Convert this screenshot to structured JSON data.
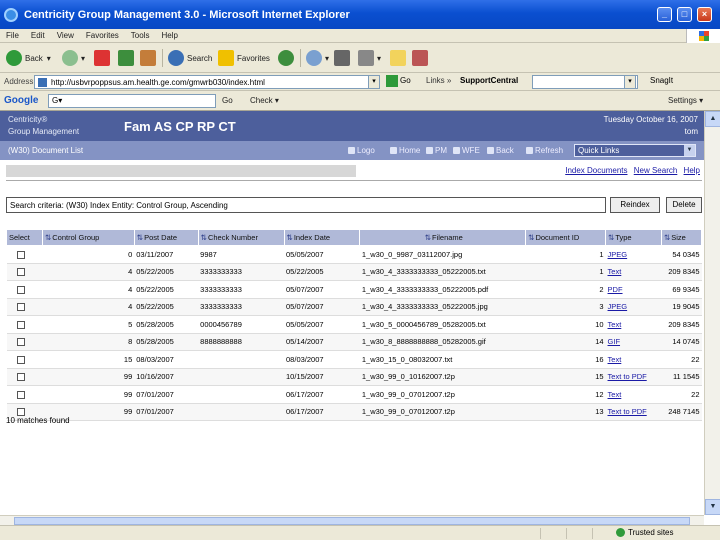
{
  "window": {
    "title": "Centricity Group Management 3.0 - Microsoft Internet Explorer",
    "minimize": "_",
    "maximize": "□",
    "close": "×"
  },
  "menu": [
    "File",
    "Edit",
    "View",
    "Favorites",
    "Tools",
    "Help"
  ],
  "toolbar": {
    "back": "Back",
    "search": "Search",
    "favorites": "Favorites"
  },
  "address": {
    "label": "Address",
    "url": "http://usbvrpoppsus.am.health.ge.com/gmwrb030/index.html",
    "go": "Go",
    "links": "Links",
    "support": "SupportCentral",
    "snagit": "SnagIt"
  },
  "google": {
    "logo": "Google",
    "input": "G▾",
    "go": "Go",
    "check": "Check ▾",
    "settings": "Settings ▾"
  },
  "app": {
    "brand_line1": "Centricity®",
    "brand_line2": "Group Management",
    "patient": "Fam AS CP RP CT",
    "date": "Tuesday October 16, 2007",
    "user": "tom",
    "page_title": "(W30) Document List",
    "nav": [
      "Logo",
      "Home",
      "PM",
      "WFE",
      "Back",
      "Refresh"
    ],
    "quick_links": "Quick Links"
  },
  "links": {
    "index": "Index Documents",
    "new_search": "New Search",
    "help": "Help"
  },
  "search": {
    "criteria": "Search criteria: (W30) Index Entity: Control Group, Ascending",
    "reindex": "Reindex",
    "delete": "Delete"
  },
  "table": {
    "headers": [
      "Select",
      "Control Group",
      "Post Date",
      "Check Number",
      "Index Date",
      "Filename",
      "Document ID",
      "Type",
      "Size"
    ],
    "rows": [
      [
        "0",
        "03/11/2007",
        "9987",
        "05/05/2007",
        "1_w30_0_9987_03112007.jpg",
        "1",
        "JPEG",
        "54 0345"
      ],
      [
        "4",
        "05/22/2005",
        "3333333333",
        "05/22/2005",
        "1_w30_4_3333333333_05222005.txt",
        "1",
        "Text",
        "209 8345"
      ],
      [
        "4",
        "05/22/2005",
        "3333333333",
        "05/07/2007",
        "1_w30_4_3333333333_05222005.pdf",
        "2",
        "PDF",
        "69 9345"
      ],
      [
        "4",
        "05/22/2005",
        "3333333333",
        "05/07/2007",
        "1_w30_4_3333333333_05222005.jpg",
        "3",
        "JPEG",
        "19 9045"
      ],
      [
        "5",
        "05/28/2005",
        "0000456789",
        "05/05/2007",
        "1_w30_5_0000456789_05282005.txt",
        "10",
        "Text",
        "209 8345"
      ],
      [
        "8",
        "05/28/2005",
        "8888888888",
        "05/14/2007",
        "1_w30_8_8888888888_05282005.gif",
        "14",
        "GIF",
        "14 0745"
      ],
      [
        "15",
        "08/03/2007",
        "",
        "08/03/2007",
        "1_w30_15_0_08032007.txt",
        "16",
        "Text",
        "22"
      ],
      [
        "99",
        "10/16/2007",
        "",
        "10/15/2007",
        "1_w30_99_0_10162007.t2p",
        "15",
        "Text to PDF",
        "11 1545"
      ],
      [
        "99",
        "07/01/2007",
        "",
        "06/17/2007",
        "1_w30_99_0_07012007.t2p",
        "12",
        "Text",
        "22"
      ],
      [
        "99",
        "07/01/2007",
        "",
        "06/17/2007",
        "1_w30_99_0_07012007.t2p",
        "13",
        "Text to PDF",
        "248 7145"
      ]
    ]
  },
  "matches": "10 matches found",
  "status": {
    "zone": "Trusted sites"
  }
}
